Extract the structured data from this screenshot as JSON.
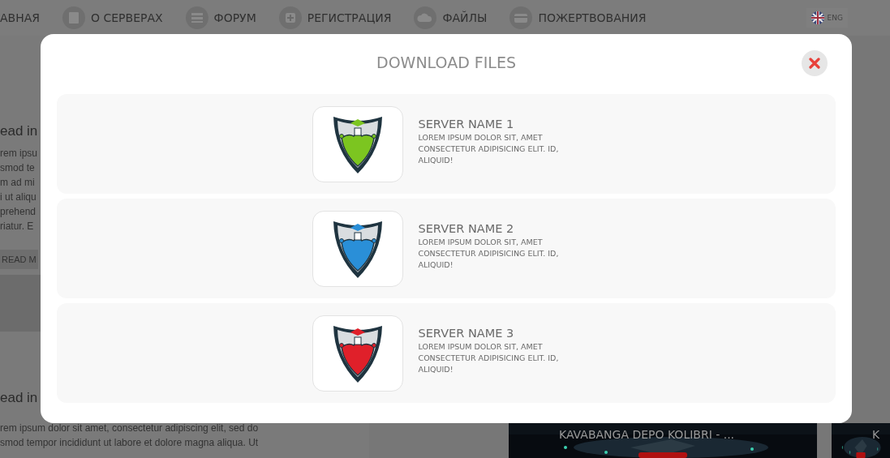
{
  "nav": {
    "items": [
      {
        "label": "АВНАЯ",
        "kind": "none"
      },
      {
        "label": "О СЕРВЕРАХ",
        "kind": "book"
      },
      {
        "label": "ФОРУМ",
        "kind": "list"
      },
      {
        "label": "РЕГИСТРАЦИЯ",
        "kind": "plus"
      },
      {
        "label": "ФАЙЛЫ",
        "kind": "cloud"
      },
      {
        "label": "ПОЖЕРТВОВАНИЯ",
        "kind": "card"
      }
    ],
    "language": "ENG"
  },
  "articles": [
    {
      "title": "ead in",
      "lines": [
        "rem ipsu",
        "smod te",
        "m ad mi",
        "i ut aliqu",
        "prehend",
        "riatur. E"
      ],
      "button": "READ M"
    },
    {
      "title": "ead in",
      "lines": [
        "rem ipsum dolor sit amet, consectetur adipiscing elit, sed do",
        "smod tempor incididunt ut labore et dolore magna aliqua. Ut"
      ]
    }
  ],
  "videos": [
    {
      "title": "KAVABANGA DEPO KOLIBRI - ...",
      "kind": "picture"
    },
    {
      "title": "K",
      "kind": "picture"
    }
  ],
  "dialog": {
    "title": "DOWNLOAD FILES",
    "servers": [
      {
        "name": "SERVER NAME 1",
        "description": "LOREM IPSUM DOLOR SIT, AMET CONSECTETUR ADIPISICING ELIT. ID, ALIQUID!",
        "color": "#7cc520"
      },
      {
        "name": "SERVER NAME 2",
        "description": "LOREM IPSUM DOLOR SIT, AMET CONSECTETUR ADIPISICING ELIT. ID, ALIQUID!",
        "color": "#2a8fd8"
      },
      {
        "name": "SERVER NAME 3",
        "description": "LOREM IPSUM DOLOR SIT, AMET CONSECTETUR ADIPISICING ELIT. ID, ALIQUID!",
        "color": "#e0202a"
      }
    ]
  }
}
